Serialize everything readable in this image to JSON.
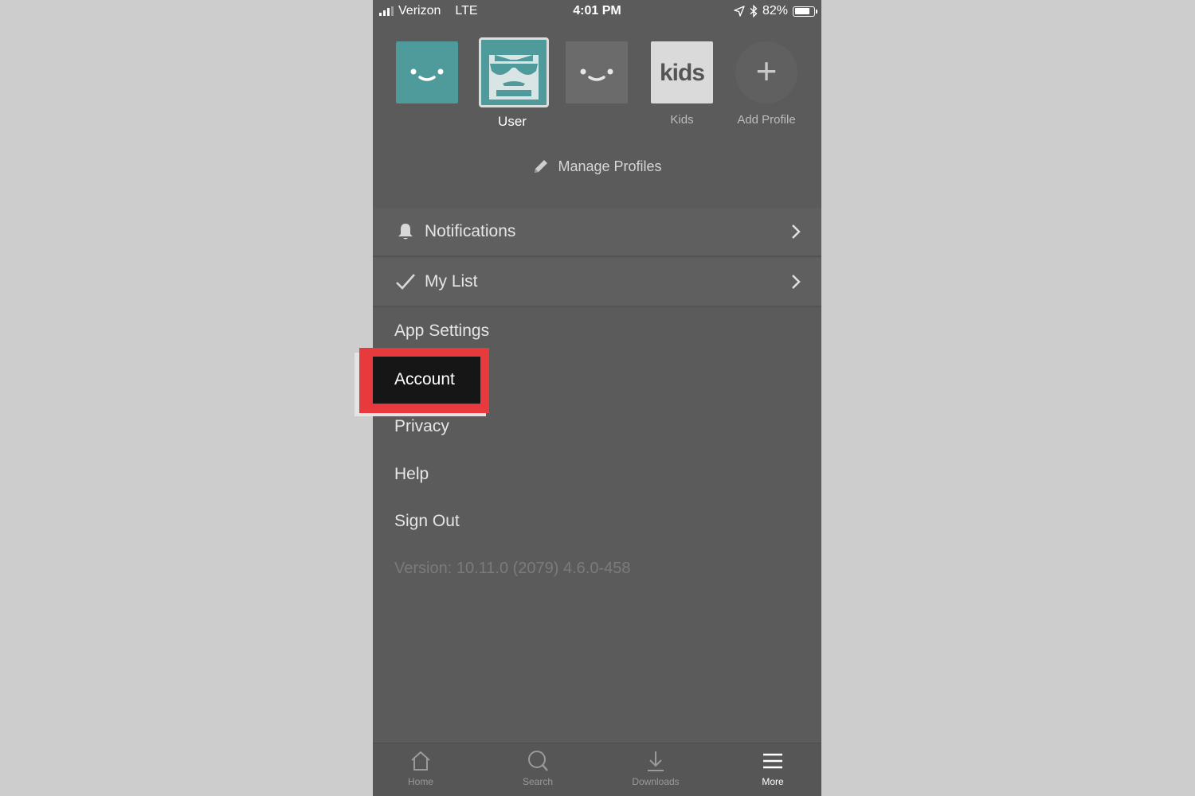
{
  "status_bar": {
    "carrier": "Verizon",
    "network": "LTE",
    "time": "4:01 PM",
    "battery_text": "82%",
    "battery_level": 0.82,
    "icons": [
      "signal-icon",
      "location-arrow-icon",
      "bluetooth-icon",
      "battery-icon"
    ]
  },
  "profiles": [
    {
      "label": "",
      "avatar": "teal-smiley",
      "selected": false
    },
    {
      "label": "User",
      "avatar": "teal-sunglasses-face",
      "selected": true
    },
    {
      "label": "",
      "avatar": "gray-smiley",
      "selected": false
    },
    {
      "label": "Kids",
      "avatar": "kids",
      "avatar_text": "kids",
      "selected": false
    },
    {
      "label": "Add Profile",
      "avatar": "add",
      "avatar_text": "+",
      "selected": false
    }
  ],
  "manage_profiles": {
    "label": "Manage Profiles",
    "icon": "pencil-icon"
  },
  "menu": {
    "notifications": {
      "label": "Notifications",
      "icon": "bell-icon"
    },
    "my_list": {
      "label": "My List",
      "icon": "checkmark-icon"
    },
    "app_settings": "App Settings",
    "account": "Account",
    "privacy": "Privacy",
    "help": "Help",
    "sign_out": "Sign Out",
    "version": "Version: 10.11.0 (2079) 4.6.0-458"
  },
  "highlight": {
    "target": "Account",
    "color": "#e8393d"
  },
  "tabs": [
    {
      "label": "Home",
      "icon": "home-icon",
      "active": false
    },
    {
      "label": "Search",
      "icon": "search-icon",
      "active": false
    },
    {
      "label": "Downloads",
      "icon": "download-icon",
      "active": false
    },
    {
      "label": "More",
      "icon": "hamburger-menu-icon",
      "active": true
    }
  ],
  "colors": {
    "background": "#cdcdcd",
    "panel": "#5b5b5b",
    "teal": "#4f9a9a",
    "accent_red": "#e8393d"
  }
}
